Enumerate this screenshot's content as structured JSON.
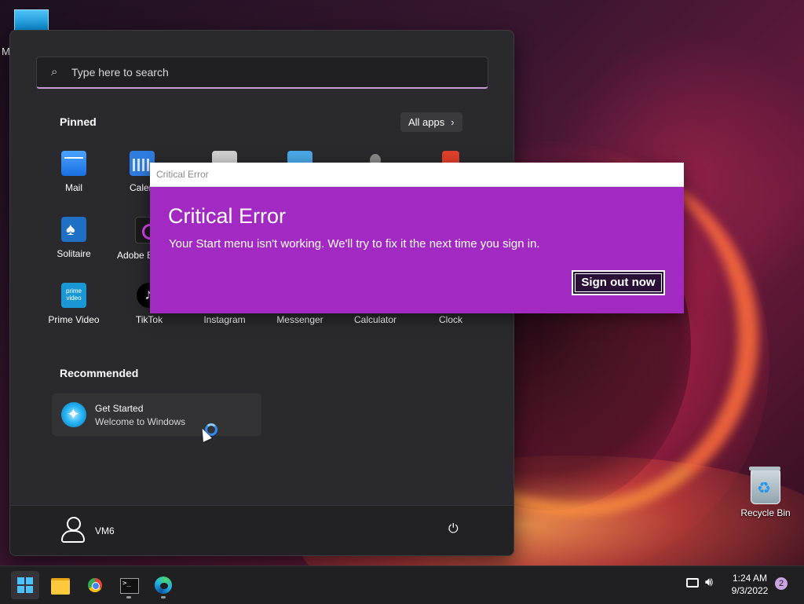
{
  "desktop": {
    "partial_label": "M",
    "recycle_bin_label": "Recycle Bin"
  },
  "start_menu": {
    "search_placeholder": "Type here to search",
    "pinned_title": "Pinned",
    "all_apps_label": "All apps",
    "pinned_row1": [
      "Mail",
      "Calen"
    ],
    "pinned_row2": [
      "Solitaire",
      "Adobe E"
    ],
    "pinned_row3": [
      "Prime Video",
      "TikTok",
      "Instagram",
      "Messenger",
      "Calculator",
      "Clock"
    ],
    "prime_logo_text": "prime video",
    "recommended_title": "Recommended",
    "recommended_item": {
      "title": "Get Started",
      "subtitle": "Welcome to Windows"
    },
    "user_name": "VM6"
  },
  "dialog": {
    "window_title": "Critical Error",
    "heading": "Critical Error",
    "message": "Your Start menu isn't working. We'll try to fix it the next time you sign in.",
    "button_label": "Sign out now"
  },
  "taskbar": {
    "clock_time": "1:24 AM",
    "clock_date": "9/3/2022",
    "notification_count": "2",
    "icons": [
      "windows-start-icon",
      "file-explorer-icon",
      "chrome-icon",
      "terminal-icon",
      "edge-icon"
    ]
  }
}
